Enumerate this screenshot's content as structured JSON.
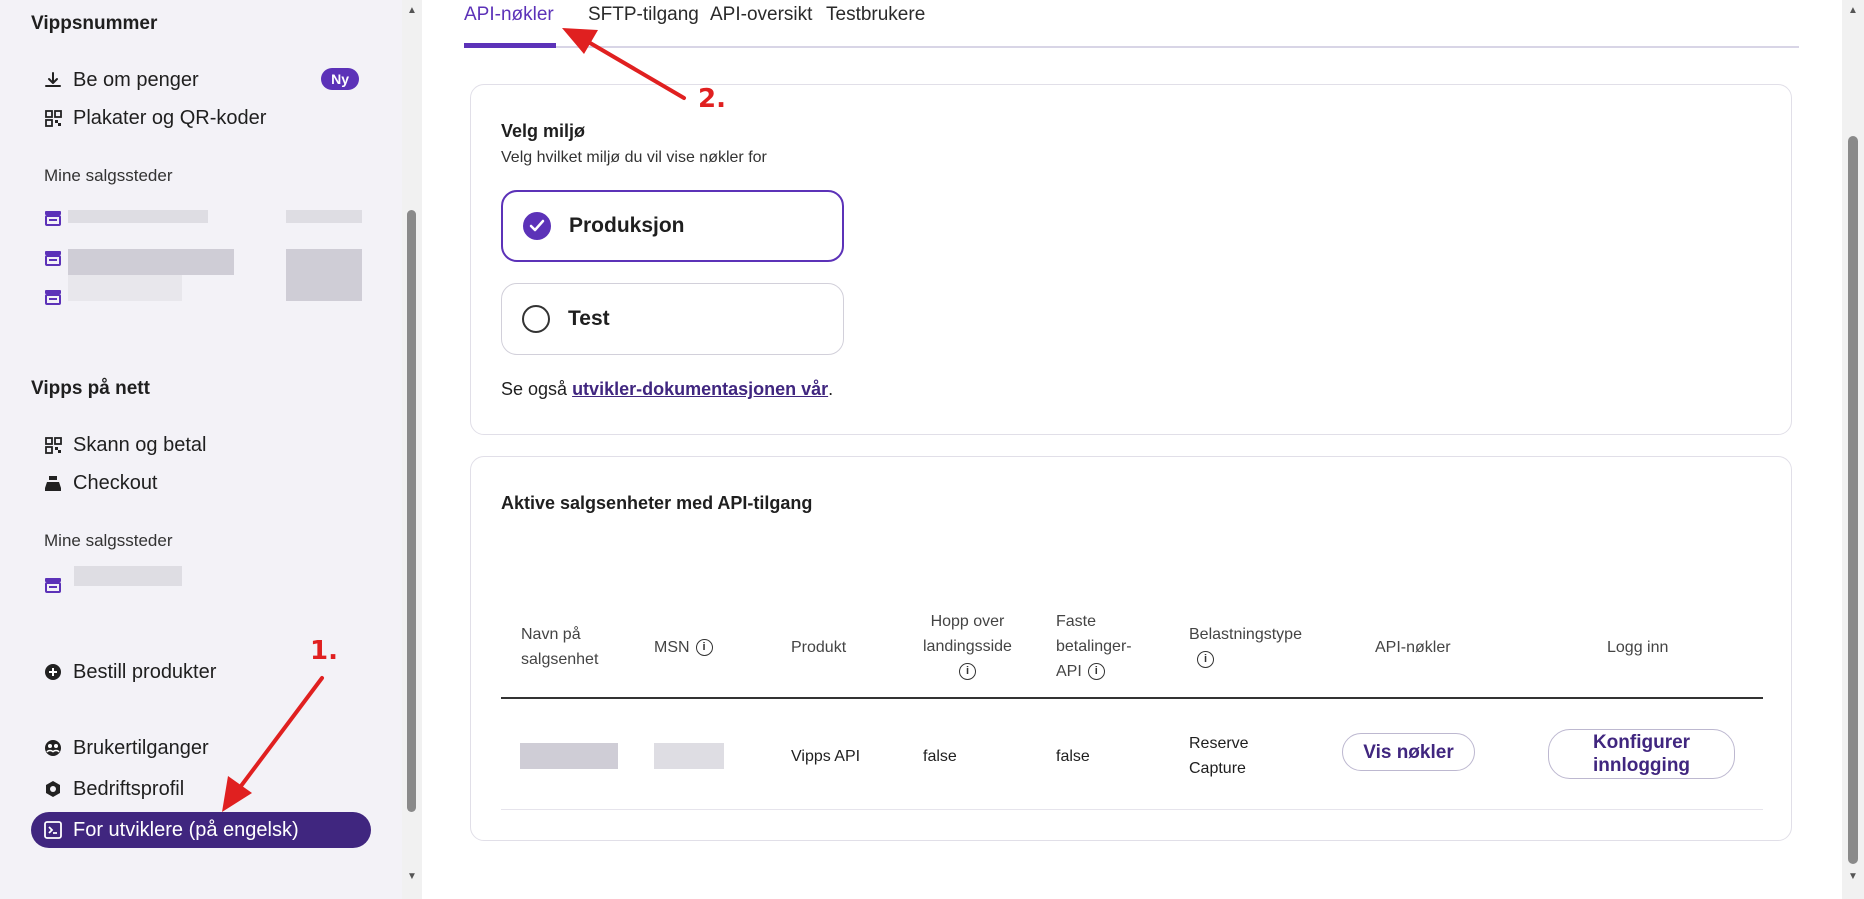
{
  "sidebar": {
    "section_vippsnummer": "Vippsnummer",
    "items_top": [
      {
        "label": "Be om penger",
        "icon": "download-icon",
        "badge": "Ny"
      },
      {
        "label": "Plakater og QR-koder",
        "icon": "qr-code-icon"
      }
    ],
    "mine_salgssteder_1": "Mine salgssteder",
    "section_vipps_pa_nett": "Vipps på nett",
    "items_nett": [
      {
        "label": "Skann og betal",
        "icon": "qr-code-icon"
      },
      {
        "label": "Checkout",
        "icon": "cash-register-icon"
      }
    ],
    "mine_salgssteder_2": "Mine salgssteder",
    "bestill": {
      "label": "Bestill produkter",
      "icon": "plus-circle-icon"
    },
    "items_bottom": [
      {
        "label": "Brukertilganger",
        "icon": "users-icon"
      },
      {
        "label": "Bedriftsprofil",
        "icon": "hexagon-icon"
      },
      {
        "label": "For utviklere (på engelsk)",
        "icon": "terminal-icon",
        "active": true
      }
    ]
  },
  "tabs": [
    {
      "label": "API-nøkler",
      "active": true
    },
    {
      "label": "SFTP-tilgang"
    },
    {
      "label": "API-oversikt"
    },
    {
      "label": "Testbrukere"
    }
  ],
  "environment": {
    "title": "Velg miljø",
    "subtitle": "Velg hvilket miljø du vil vise nøkler for",
    "options": [
      {
        "label": "Produksjon",
        "selected": true
      },
      {
        "label": "Test",
        "selected": false
      }
    ],
    "see_also_prefix": "Se også ",
    "see_also_link": "utvikler-dokumentasjonen vår",
    "see_also_suffix": "."
  },
  "sales_units": {
    "title": "Aktive salgsenheter med API-tilgang",
    "columns": [
      {
        "lines": [
          "Navn på",
          "salgsenhet"
        ]
      },
      {
        "lines": [
          "MSN"
        ],
        "info": true
      },
      {
        "lines": [
          "Produkt"
        ]
      },
      {
        "lines": [
          "Hopp over",
          "landingsside"
        ],
        "info": true
      },
      {
        "lines": [
          "Faste",
          "betalinger-",
          "API"
        ],
        "info": true
      },
      {
        "lines": [
          "Belastningstype"
        ],
        "info": true
      },
      {
        "lines": [
          "API-nøkler"
        ]
      },
      {
        "lines": [
          "Logg inn"
        ]
      }
    ],
    "rows": [
      {
        "produkt": "Vipps API",
        "hopp_over": "false",
        "faste_betalinger": "false",
        "belastningstype": [
          "Reserve",
          "Capture"
        ],
        "vis_nokler": "Vis nøkler",
        "konfigurer": [
          "Konfigurer",
          "innlogging"
        ]
      }
    ]
  },
  "annotations": {
    "step1": "1.",
    "step2": "2."
  },
  "colors": {
    "accent": "#5c32b8",
    "active_nav": "#40267f",
    "annotation": "#e02020"
  }
}
